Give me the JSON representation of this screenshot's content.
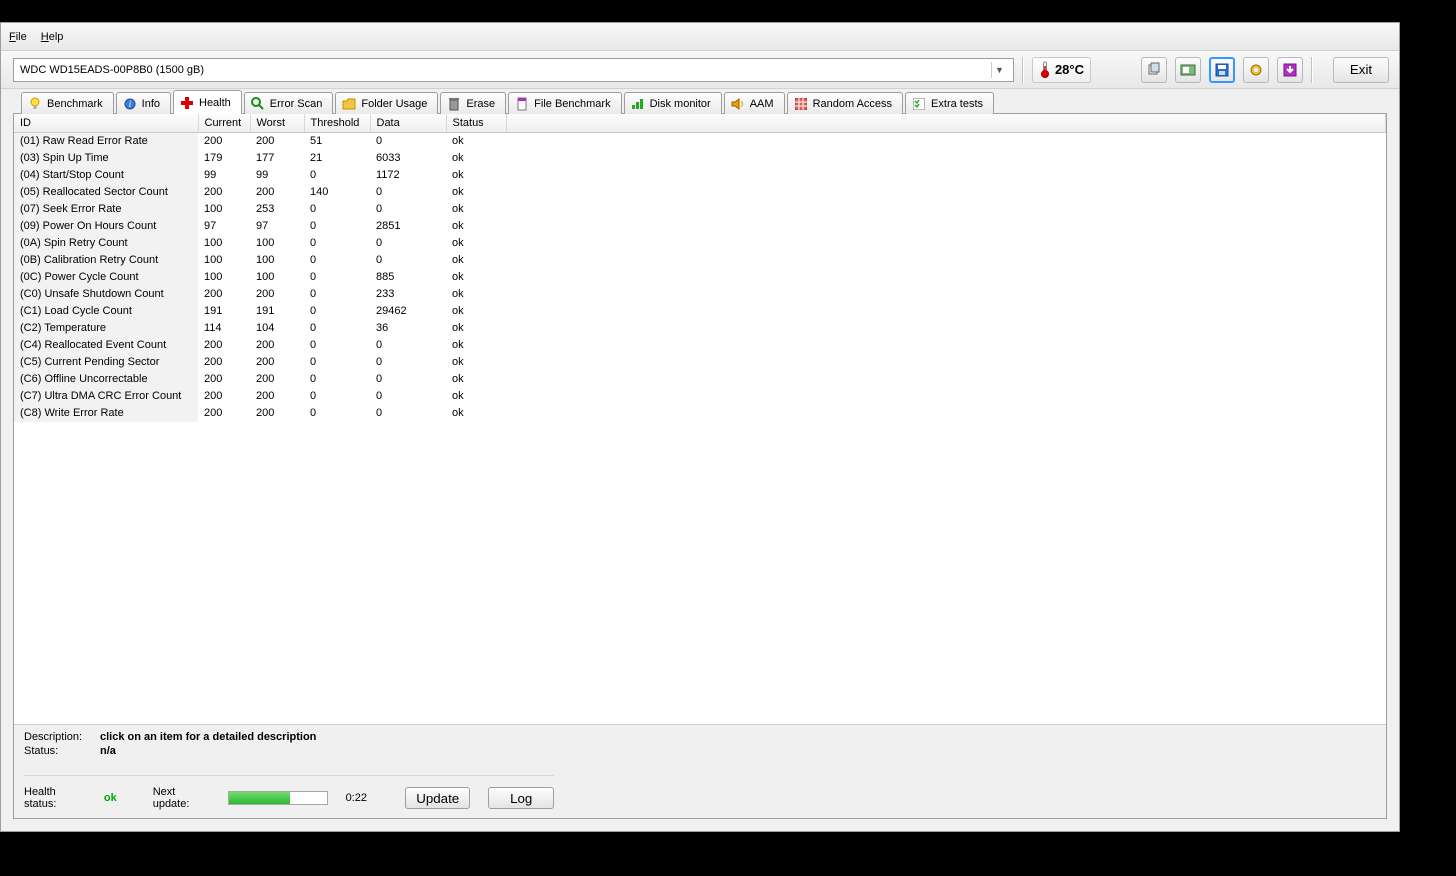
{
  "menu": {
    "file": "File",
    "help": "Help"
  },
  "toolbar": {
    "drive_selected": "WDC WD15EADS-00P8B0 (1500 gB)",
    "temperature": "28°C",
    "exit_label": "Exit"
  },
  "tabs": [
    {
      "label": "Benchmark"
    },
    {
      "label": "Info"
    },
    {
      "label": "Health"
    },
    {
      "label": "Error Scan"
    },
    {
      "label": "Folder Usage"
    },
    {
      "label": "Erase"
    },
    {
      "label": "File Benchmark"
    },
    {
      "label": "Disk monitor"
    },
    {
      "label": "AAM"
    },
    {
      "label": "Random Access"
    },
    {
      "label": "Extra tests"
    }
  ],
  "table": {
    "headers": {
      "id": "ID",
      "current": "Current",
      "worst": "Worst",
      "threshold": "Threshold",
      "data": "Data",
      "status": "Status"
    },
    "rows": [
      {
        "id": "(01) Raw Read Error Rate",
        "current": "200",
        "worst": "200",
        "threshold": "51",
        "data": "0",
        "status": "ok"
      },
      {
        "id": "(03) Spin Up Time",
        "current": "179",
        "worst": "177",
        "threshold": "21",
        "data": "6033",
        "status": "ok"
      },
      {
        "id": "(04) Start/Stop Count",
        "current": "99",
        "worst": "99",
        "threshold": "0",
        "data": "1172",
        "status": "ok"
      },
      {
        "id": "(05) Reallocated Sector Count",
        "current": "200",
        "worst": "200",
        "threshold": "140",
        "data": "0",
        "status": "ok"
      },
      {
        "id": "(07) Seek Error Rate",
        "current": "100",
        "worst": "253",
        "threshold": "0",
        "data": "0",
        "status": "ok"
      },
      {
        "id": "(09) Power On Hours Count",
        "current": "97",
        "worst": "97",
        "threshold": "0",
        "data": "2851",
        "status": "ok"
      },
      {
        "id": "(0A) Spin Retry Count",
        "current": "100",
        "worst": "100",
        "threshold": "0",
        "data": "0",
        "status": "ok"
      },
      {
        "id": "(0B) Calibration Retry Count",
        "current": "100",
        "worst": "100",
        "threshold": "0",
        "data": "0",
        "status": "ok"
      },
      {
        "id": "(0C) Power Cycle Count",
        "current": "100",
        "worst": "100",
        "threshold": "0",
        "data": "885",
        "status": "ok"
      },
      {
        "id": "(C0) Unsafe Shutdown Count",
        "current": "200",
        "worst": "200",
        "threshold": "0",
        "data": "233",
        "status": "ok"
      },
      {
        "id": "(C1) Load Cycle Count",
        "current": "191",
        "worst": "191",
        "threshold": "0",
        "data": "29462",
        "status": "ok"
      },
      {
        "id": "(C2) Temperature",
        "current": "114",
        "worst": "104",
        "threshold": "0",
        "data": "36",
        "status": "ok"
      },
      {
        "id": "(C4) Reallocated Event Count",
        "current": "200",
        "worst": "200",
        "threshold": "0",
        "data": "0",
        "status": "ok"
      },
      {
        "id": "(C5) Current Pending Sector",
        "current": "200",
        "worst": "200",
        "threshold": "0",
        "data": "0",
        "status": "ok"
      },
      {
        "id": "(C6) Offline Uncorrectable",
        "current": "200",
        "worst": "200",
        "threshold": "0",
        "data": "0",
        "status": "ok"
      },
      {
        "id": "(C7) Ultra DMA CRC Error Count",
        "current": "200",
        "worst": "200",
        "threshold": "0",
        "data": "0",
        "status": "ok"
      },
      {
        "id": "(C8) Write Error Rate",
        "current": "200",
        "worst": "200",
        "threshold": "0",
        "data": "0",
        "status": "ok"
      }
    ]
  },
  "bottom": {
    "description_label": "Description:",
    "description_value": "click on an item for a detailed description",
    "status_label": "Status:",
    "status_value": "n/a",
    "health_status_label": "Health status:",
    "health_status_value": "ok",
    "next_update_label": "Next update:",
    "next_update_time": "0:22",
    "update_label": "Update",
    "log_label": "Log"
  }
}
